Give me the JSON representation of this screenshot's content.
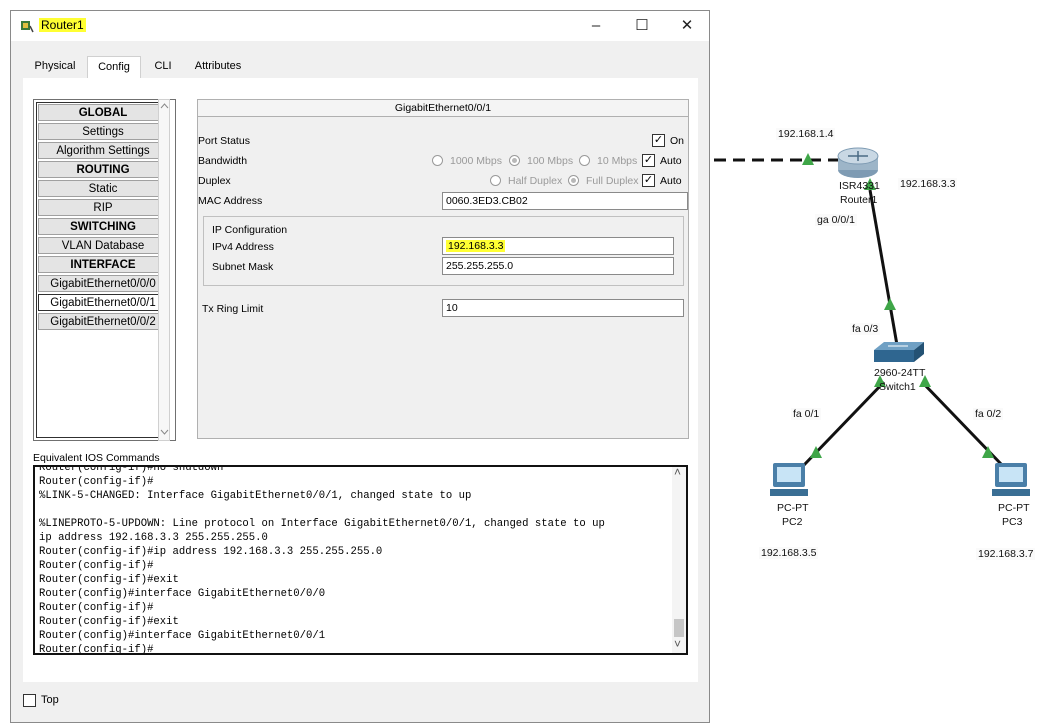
{
  "window": {
    "title": "Router1",
    "minimize_glyph": "–",
    "maximize_glyph": "☐",
    "close_glyph": "✕"
  },
  "tabs": [
    {
      "label": "Physical"
    },
    {
      "label": "Config"
    },
    {
      "label": "CLI"
    },
    {
      "label": "Attributes"
    }
  ],
  "sidebar": {
    "items": [
      {
        "label": "GLOBAL"
      },
      {
        "label": "Settings"
      },
      {
        "label": "Algorithm Settings"
      },
      {
        "label": "ROUTING"
      },
      {
        "label": "Static"
      },
      {
        "label": "RIP"
      },
      {
        "label": "SWITCHING"
      },
      {
        "label": "VLAN Database"
      },
      {
        "label": "INTERFACE"
      },
      {
        "label": "GigabitEthernet0/0/0"
      },
      {
        "label": "GigabitEthernet0/0/1"
      },
      {
        "label": "GigabitEthernet0/0/2"
      }
    ]
  },
  "panel": {
    "title": "GigabitEthernet0/0/1",
    "port_status_label": "Port Status",
    "port_status_on_label": "On",
    "bandwidth_label": "Bandwidth",
    "bw_1000": "1000 Mbps",
    "bw_100": "100 Mbps",
    "bw_10": "10 Mbps",
    "bw_auto": "Auto",
    "duplex_label": "Duplex",
    "half_duplex": "Half Duplex",
    "full_duplex": "Full Duplex",
    "duplex_auto": "Auto",
    "mac_label": "MAC Address",
    "mac_value": "0060.3ED3.CB02",
    "ip_config_label": "IP Configuration",
    "ipv4_label": "IPv4 Address",
    "ipv4_value": "192.168.3.3",
    "mask_label": "Subnet Mask",
    "mask_value": "255.255.255.0",
    "tx_label": "Tx Ring Limit",
    "tx_value": "10"
  },
  "ios": {
    "label": "Equivalent IOS Commands",
    "text": "Router(config-if)#no shutdown\nRouter(config-if)#\n%LINK-5-CHANGED: Interface GigabitEthernet0/0/1, changed state to up\n\n%LINEPROTO-5-UPDOWN: Line protocol on Interface GigabitEthernet0/0/1, changed state to up\nip address 192.168.3.3 255.255.255.0\nRouter(config-if)#ip address 192.168.3.3 255.255.255.0\nRouter(config-if)#\nRouter(config-if)#exit\nRouter(config)#interface GigabitEthernet0/0/0\nRouter(config-if)#\nRouter(config-if)#exit\nRouter(config)#interface GigabitEthernet0/0/1\nRouter(config-if)#",
    "scroll_up": "˄",
    "scroll_down": "˅"
  },
  "top_label": "Top",
  "topology": {
    "router_ip_left": "192.168.1.4",
    "router_model": "ISR4331",
    "router_name": "Router1",
    "router_ip_right": "192.168.3.3",
    "router_port": "ga 0/0/1",
    "switch_port_up": "fa 0/3",
    "switch_model": "2960-24TT",
    "switch_name": "Switch1",
    "switch_port_left": "fa 0/1",
    "switch_port_right": "fa 0/2",
    "pc2_type": "PC-PT",
    "pc2_name": "PC2",
    "pc2_ip": "192.168.3.5",
    "pc3_type": "PC-PT",
    "pc3_name": "PC3",
    "pc3_ip": "192.168.3.7"
  },
  "colors": {
    "highlight": "#ffff33",
    "link_up": "#3fa648",
    "tab_underline": "#3a6ed8"
  }
}
